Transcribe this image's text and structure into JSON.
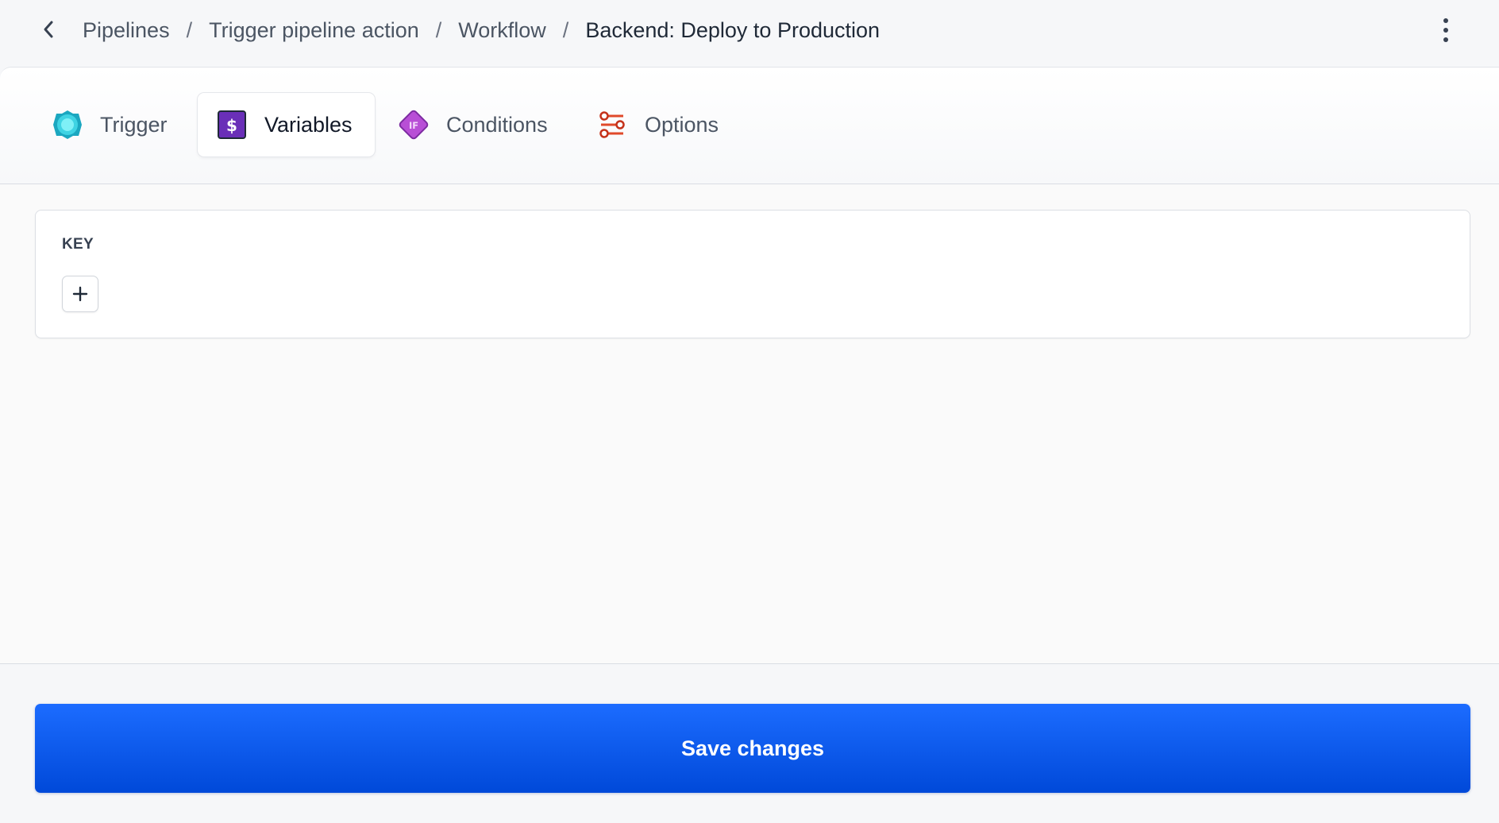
{
  "breadcrumb": {
    "items": [
      "Pipelines",
      "Trigger pipeline action",
      "Workflow"
    ],
    "current": "Backend: Deploy to Production",
    "separator": "/"
  },
  "tabs": [
    {
      "label": "Trigger",
      "icon": "trigger-icon",
      "active": false
    },
    {
      "label": "Variables",
      "icon": "variables-icon",
      "active": true
    },
    {
      "label": "Conditions",
      "icon": "conditions-icon",
      "active": false
    },
    {
      "label": "Options",
      "icon": "options-icon",
      "active": false
    }
  ],
  "variables": {
    "column_header": "KEY",
    "add_icon": "plus-icon"
  },
  "footer": {
    "save_label": "Save changes"
  },
  "colors": {
    "primary": "#0a5cff",
    "trigger_icon": "#2ec4d6",
    "variables_icon": "#6a2fb8",
    "conditions_icon": "#b84fd6",
    "options_icon": "#e04a2a"
  }
}
